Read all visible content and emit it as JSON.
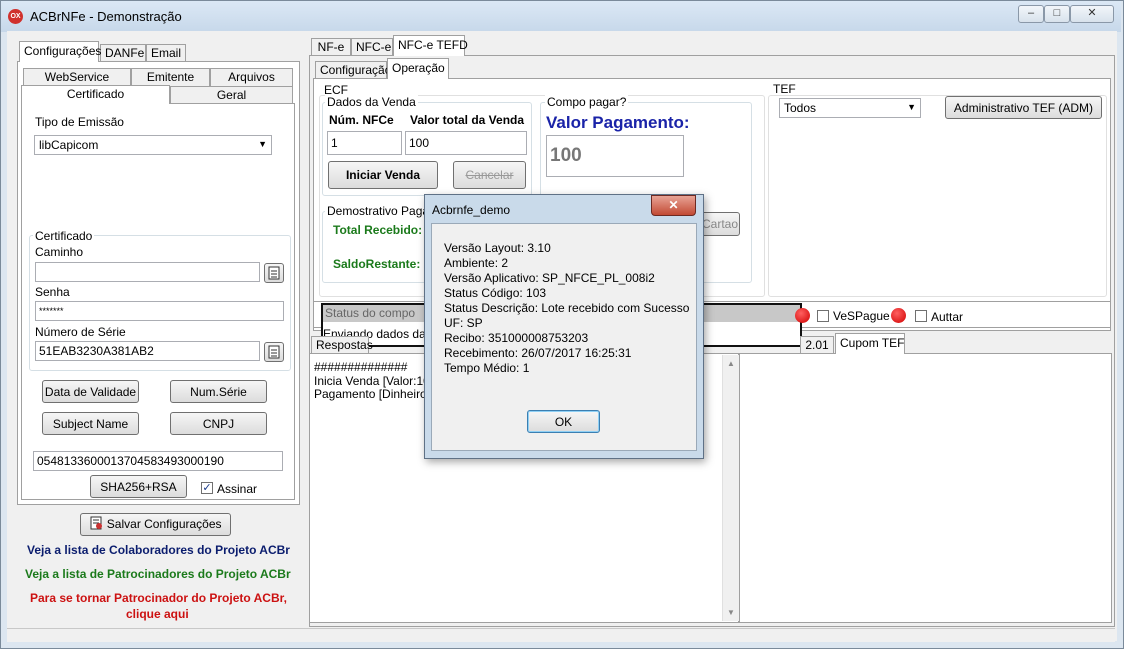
{
  "window": {
    "title": "ACBrNFe - Demonstração",
    "min": "–",
    "max": "□",
    "close": "✕"
  },
  "left_tabs": [
    "Configurações",
    "DANFe",
    "Email"
  ],
  "sub_tabs_top": [
    "WebService",
    "Emitente",
    "Arquivos"
  ],
  "sub_tabs_bottom": [
    "Certificado",
    "Geral"
  ],
  "cert": {
    "tipo_emissao_label": "Tipo de Emissão",
    "tipo_emissao_value": "libCapicom",
    "group_title": "Certificado",
    "caminho_label": "Caminho",
    "caminho_value": "",
    "senha_label": "Senha",
    "senha_value": "*******",
    "numserie_label": "Número de Série",
    "numserie_value": "51EAB3230A381AB2",
    "btn_data_validade": "Data de Validade",
    "btn_num_serie": "Num.Série",
    "btn_subject": "Subject Name",
    "btn_cnpj": "CNPJ",
    "hash_value": "0548133600013704583493000190",
    "btn_sha": "SHA256+RSA",
    "assinar_label": "Assinar",
    "assinar_checked": "✓"
  },
  "save_button": "Salvar Configurações",
  "links": {
    "colaboradores": "Veja a lista de Colaboradores do Projeto ACBr",
    "patrocinadores": "Veja a lista de Patrocinadores do Projeto ACBr",
    "tornar1": "Para se tornar Patrocinador do Projeto ACBr,",
    "tornar2": "clique aqui",
    "colors": {
      "colab": "#0b1d6e",
      "patro": "#1b7a1b",
      "tornar": "#cc1111"
    }
  },
  "right_tabs": [
    "NF-e",
    "NFC-e",
    "NFC-e TEFD"
  ],
  "right_sub_tabs": [
    "Configuração",
    "Operação"
  ],
  "ecf": {
    "title": "ECF",
    "dados_venda": "Dados da Venda",
    "num_nfce_label": "Núm. NFCe",
    "num_nfce_value": "1",
    "valor_total_label": "Valor total da Venda",
    "valor_total_value": "100",
    "iniciar": "Iniciar Venda",
    "cancelar": "Cancelar",
    "compo_pagar": "Compo pagar?",
    "valor_pag_label": "Valor Pagamento:",
    "valor_pag_value": "100",
    "demonstrativo": "Demostrativo Pagam",
    "total_recebido": "Total Recebido:",
    "saldo_restante": "SaldoRestante:",
    "cartao_btn": "Cartao"
  },
  "tef": {
    "title": "TEF",
    "select_value": "Todos",
    "adm_btn": "Administrativo TEF (ADM)"
  },
  "status_row": {
    "status_label": "Status do compo",
    "enviando": "Enviando dados da N",
    "vespague": "VeSPague",
    "auttar": "Auttar"
  },
  "bottom_tabs": {
    "respostas": "Respostas",
    "hidden_tab": "2.01",
    "cupom_tef": "Cupom TEF"
  },
  "log": {
    "line1": "##############",
    "line2": "Inicia Venda [Valor:100",
    "line3": "Pagamento [Dinheiro:1"
  },
  "dialog": {
    "title": "Acbrnfe_demo",
    "close": "✕",
    "lines": [
      "Versão Layout: 3.10",
      "Ambiente: 2",
      "Versão Aplicativo: SP_NFCE_PL_008i2",
      "Status Código: 103",
      "Status Descrição: Lote recebido com Sucesso",
      "UF: SP",
      "Recibo: 351000008753203",
      "Recebimento: 26/07/2017 16:25:31",
      "Tempo Médio: 1"
    ],
    "ok": "OK"
  }
}
